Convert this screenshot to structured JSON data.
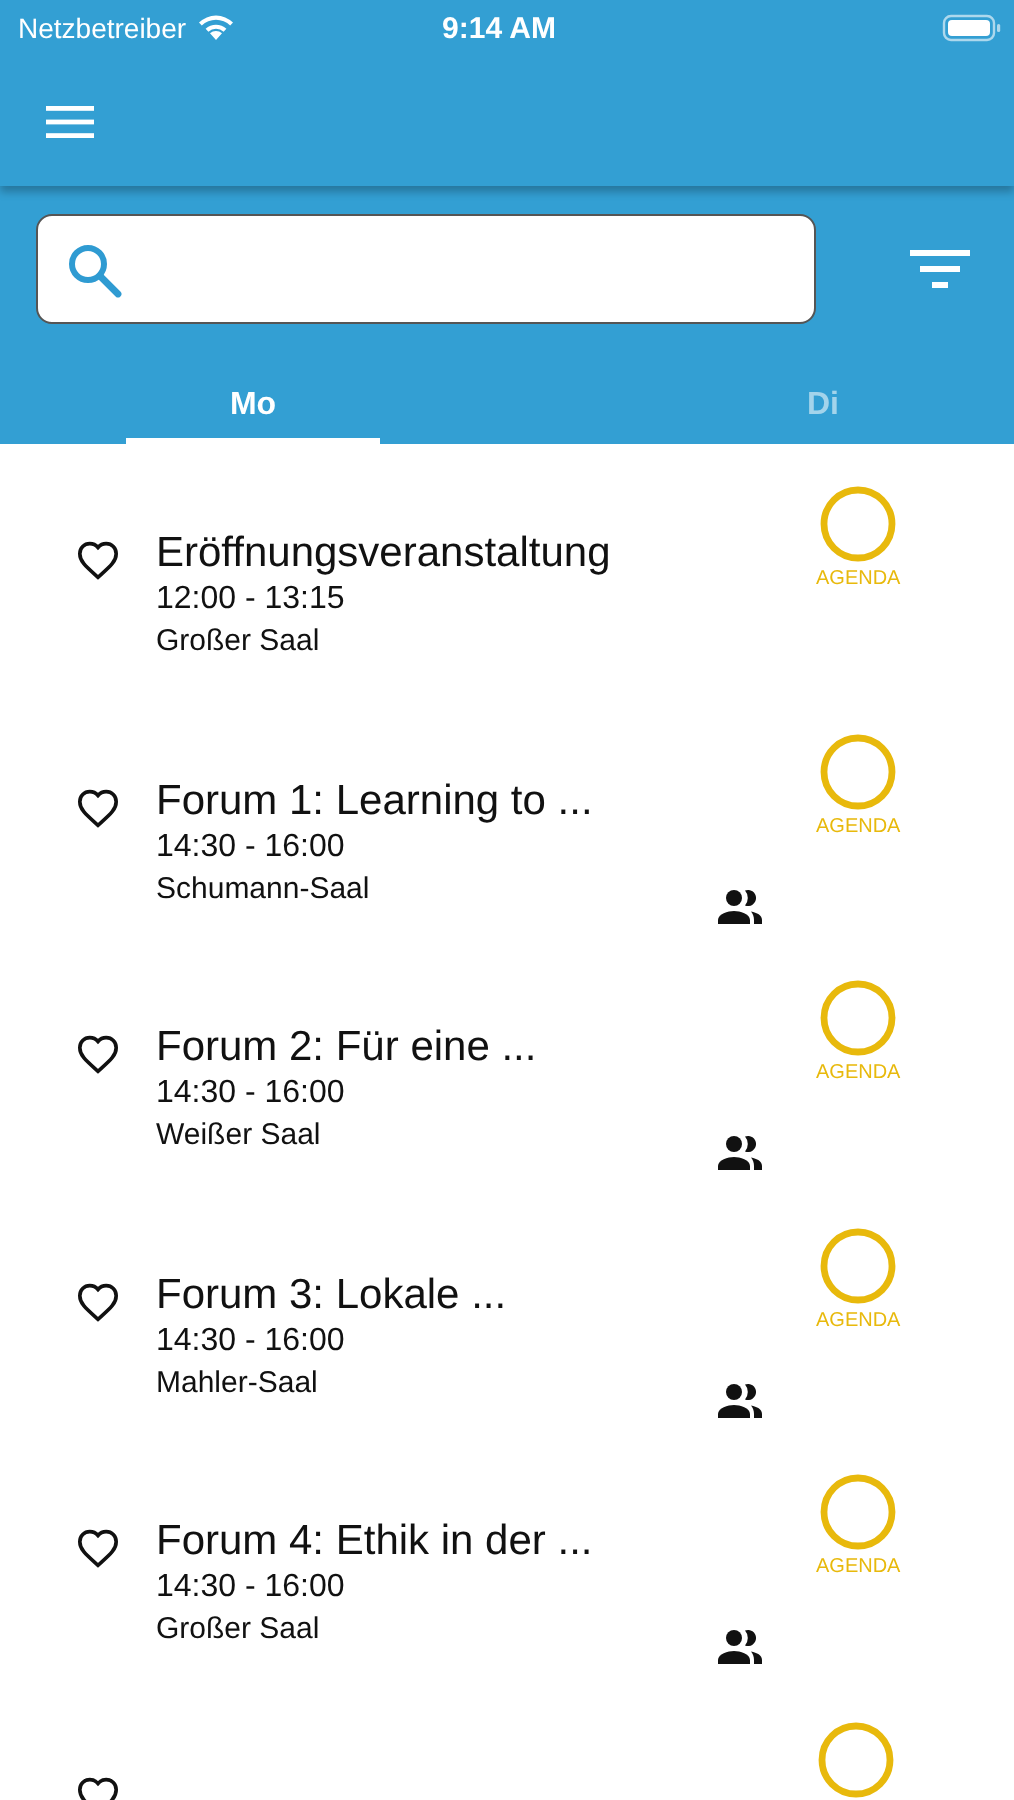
{
  "status_bar": {
    "carrier": "Netzbetreiber",
    "time": "9:14 AM"
  },
  "tabs": [
    {
      "label": "Mo",
      "selected": true
    },
    {
      "label": "Di",
      "selected": false
    }
  ],
  "sessions": [
    {
      "title": "Eröffnungsveranstaltung",
      "time": "12:00 - 13:15",
      "room": "Großer Saal",
      "favorite": false,
      "in_agenda": false,
      "agenda_label": "AGENDA",
      "group": false
    },
    {
      "title": "Forum 1: Learning to ...",
      "time": "14:30 - 16:00",
      "room": "Schumann-Saal",
      "favorite": false,
      "in_agenda": false,
      "agenda_label": "AGENDA",
      "group": true
    },
    {
      "title": "Forum 2: Für eine ...",
      "time": "14:30 - 16:00",
      "room": "Weißer Saal",
      "favorite": false,
      "in_agenda": false,
      "agenda_label": "AGENDA",
      "group": true
    },
    {
      "title": "Forum 3: Lokale ...",
      "time": "14:30 - 16:00",
      "room": "Mahler-Saal",
      "favorite": false,
      "in_agenda": false,
      "agenda_label": "AGENDA",
      "group": true
    },
    {
      "title": "Forum 4: Ethik in der ...",
      "time": "14:30 - 16:00",
      "room": "Großer Saal",
      "favorite": false,
      "in_agenda": false,
      "agenda_label": "AGENDA",
      "group": true
    },
    {
      "favorite": false,
      "in_agenda": false
    }
  ]
}
